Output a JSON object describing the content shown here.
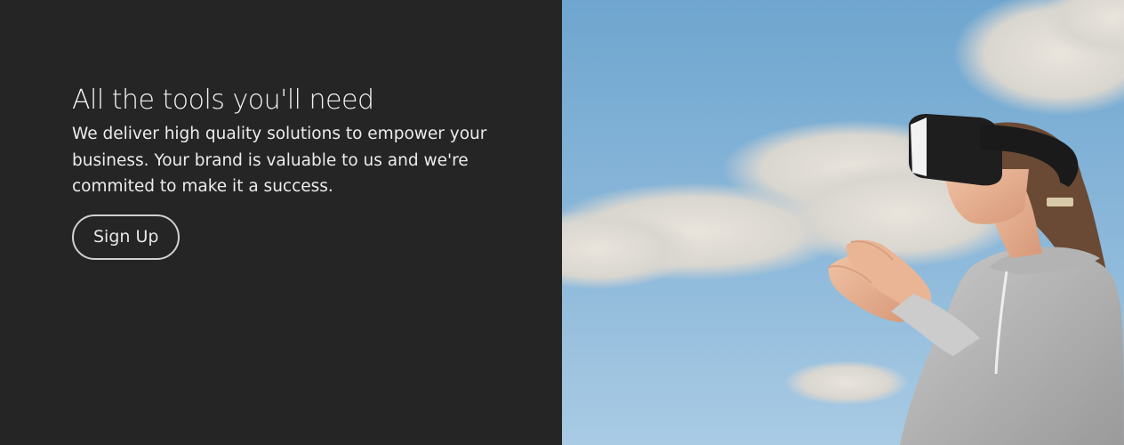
{
  "hero": {
    "title": "All the tools you'll need",
    "description": "We deliver high quality solutions to empower your business. Your brand is valuable to us and we're commited to make it a success.",
    "cta_label": "Sign Up"
  },
  "colors": {
    "panel_bg": "#252525",
    "sky": "#86b3d6",
    "text": "#f0f0f0"
  }
}
